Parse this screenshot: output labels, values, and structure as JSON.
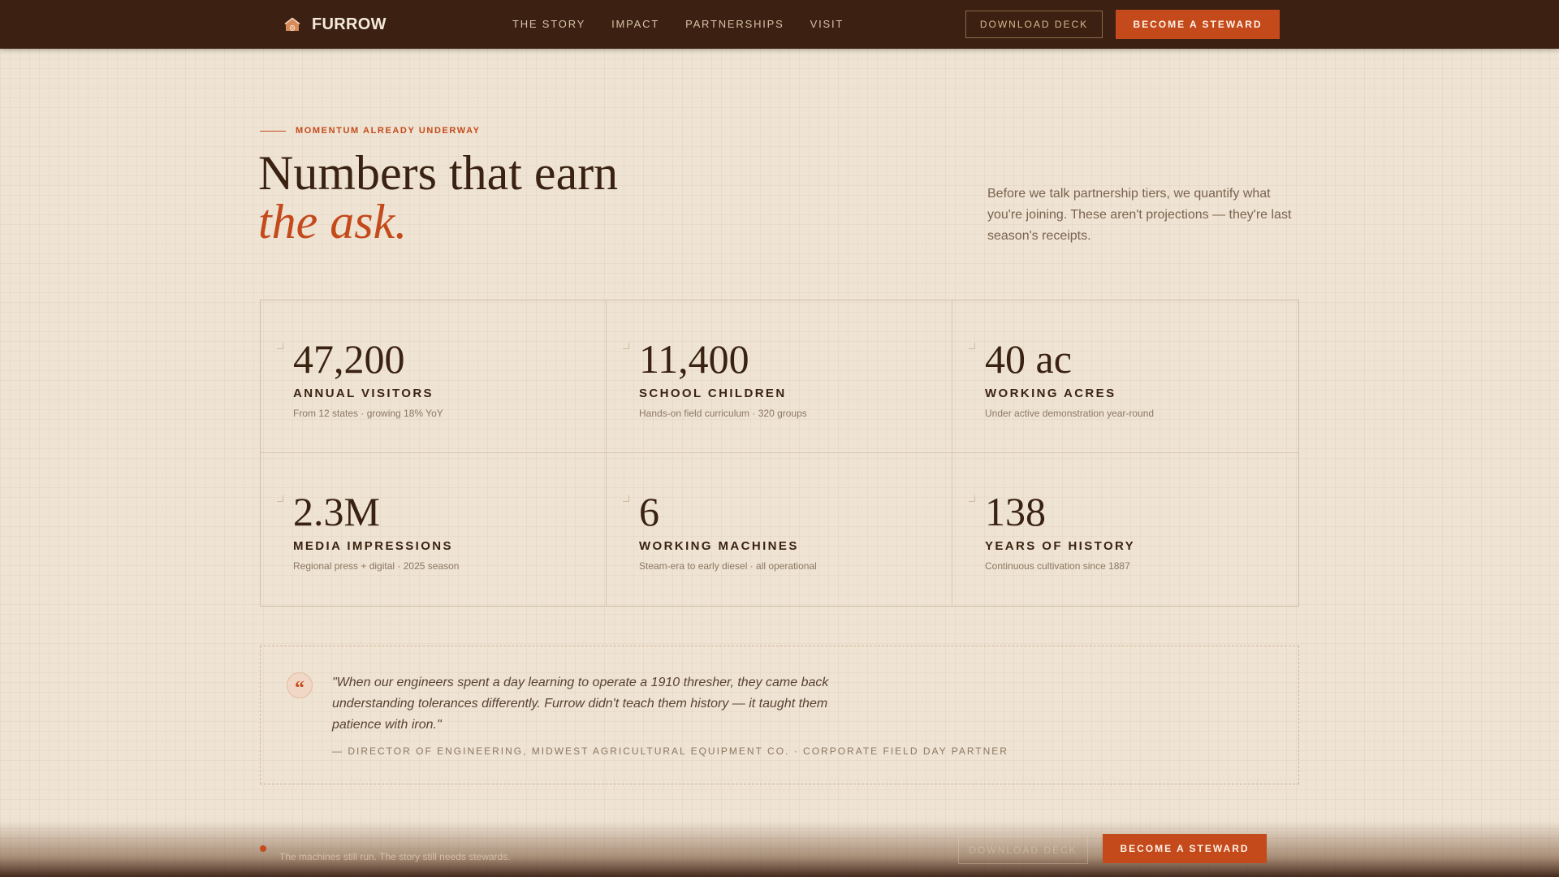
{
  "nav": {
    "brand": "FURROW",
    "brand_icon": "barn-icon",
    "links": [
      "THE STORY",
      "IMPACT",
      "PARTNERSHIPS",
      "VISIT"
    ],
    "download_label": "DOWNLOAD DECK",
    "cta_label": "BECOME A STEWARD"
  },
  "hero": {
    "eyebrow": "MOMENTUM ALREADY UNDERWAY",
    "headline": "Numbers that earn",
    "headline_accent": "the ask.",
    "intro": "Before we talk partnership tiers, we quantify what you're joining. These aren't projections — they're last season's receipts."
  },
  "stats": [
    {
      "value": "47,200",
      "label": "ANNUAL VISITORS",
      "sub": "From 12 states · growing 18% YoY"
    },
    {
      "value": "11,400",
      "label": "SCHOOL CHILDREN",
      "sub": "Hands-on field curriculum · 320 groups"
    },
    {
      "value": "40 ac",
      "label": "WORKING ACRES",
      "sub": "Under active demonstration year-round"
    },
    {
      "value": "2.3M",
      "label": "MEDIA IMPRESSIONS",
      "sub": "Regional press + digital · 2025 season"
    },
    {
      "value": "6",
      "label": "WORKING MACHINES",
      "sub": "Steam-era to early diesel · all operational"
    },
    {
      "value": "138",
      "label": "YEARS OF HISTORY",
      "sub": "Continuous cultivation since 1887"
    }
  ],
  "quote": {
    "mark": "“",
    "text": "\"When our engineers spent a day learning to operate a 1910 thresher, they came back understanding tolerances differently. Furrow didn't teach them history — it taught them patience with iron.\"",
    "attribution": "— DIRECTOR OF ENGINEERING, MIDWEST AGRICULTURAL EQUIPMENT CO. · CORPORATE FIELD DAY PARTNER"
  },
  "bottom_bar": {
    "text": "The machines still run. The story still needs stewards.",
    "download_label": "DOWNLOAD DECK",
    "cta_label": "BECOME A STEWARD"
  },
  "colors": {
    "accent": "#c44a1c",
    "nav_bg": "#3c2113",
    "page_bg": "#efe4d3",
    "ink": "#3a2212"
  }
}
